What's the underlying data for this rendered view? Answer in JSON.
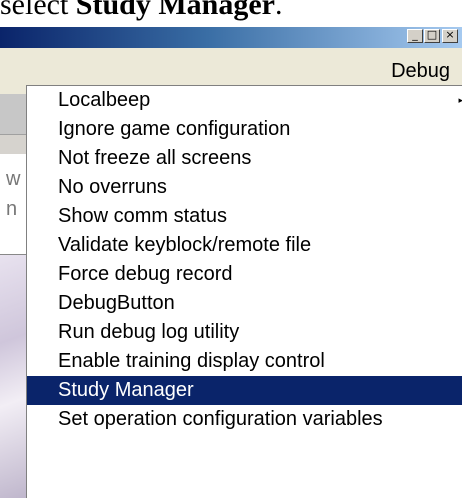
{
  "caption": {
    "prefix": "select ",
    "bold": "Study Manager",
    "suffix": "."
  },
  "window": {
    "buttons": [
      {
        "name": "minimize",
        "glyph": "_"
      },
      {
        "name": "maximize",
        "glyph": "□"
      },
      {
        "name": "close",
        "glyph": "×"
      }
    ]
  },
  "menu_bar": {
    "debug_label": "Debug"
  },
  "left_panel": {
    "fragment_1": "w",
    "fragment_2": "n"
  },
  "dropdown": {
    "items": [
      {
        "label": "Localbeep",
        "has_submenu": true,
        "submenu_glyph": "▸",
        "highlighted": false
      },
      {
        "label": "Ignore game configuration",
        "has_submenu": false,
        "highlighted": false
      },
      {
        "label": "Not freeze all screens",
        "has_submenu": false,
        "highlighted": false
      },
      {
        "label": "No overruns",
        "has_submenu": false,
        "highlighted": false
      },
      {
        "label": "Show comm status",
        "has_submenu": false,
        "highlighted": false
      },
      {
        "label": "Validate keyblock/remote file",
        "has_submenu": false,
        "highlighted": false
      },
      {
        "label": "Force debug record",
        "has_submenu": false,
        "highlighted": false
      },
      {
        "label": "DebugButton",
        "has_submenu": false,
        "highlighted": false
      },
      {
        "label": "Run debug log utility",
        "has_submenu": false,
        "highlighted": false
      },
      {
        "label": "Enable training display control",
        "has_submenu": false,
        "highlighted": false
      },
      {
        "label": "Study Manager",
        "has_submenu": false,
        "highlighted": true
      },
      {
        "label": "Set operation configuration variables",
        "has_submenu": false,
        "highlighted": false
      }
    ]
  },
  "colors": {
    "highlight_bg": "#0a246a",
    "highlight_text": "#ffffff",
    "title_gradient_start": "#0a246a",
    "title_gradient_end": "#a6caf0"
  }
}
